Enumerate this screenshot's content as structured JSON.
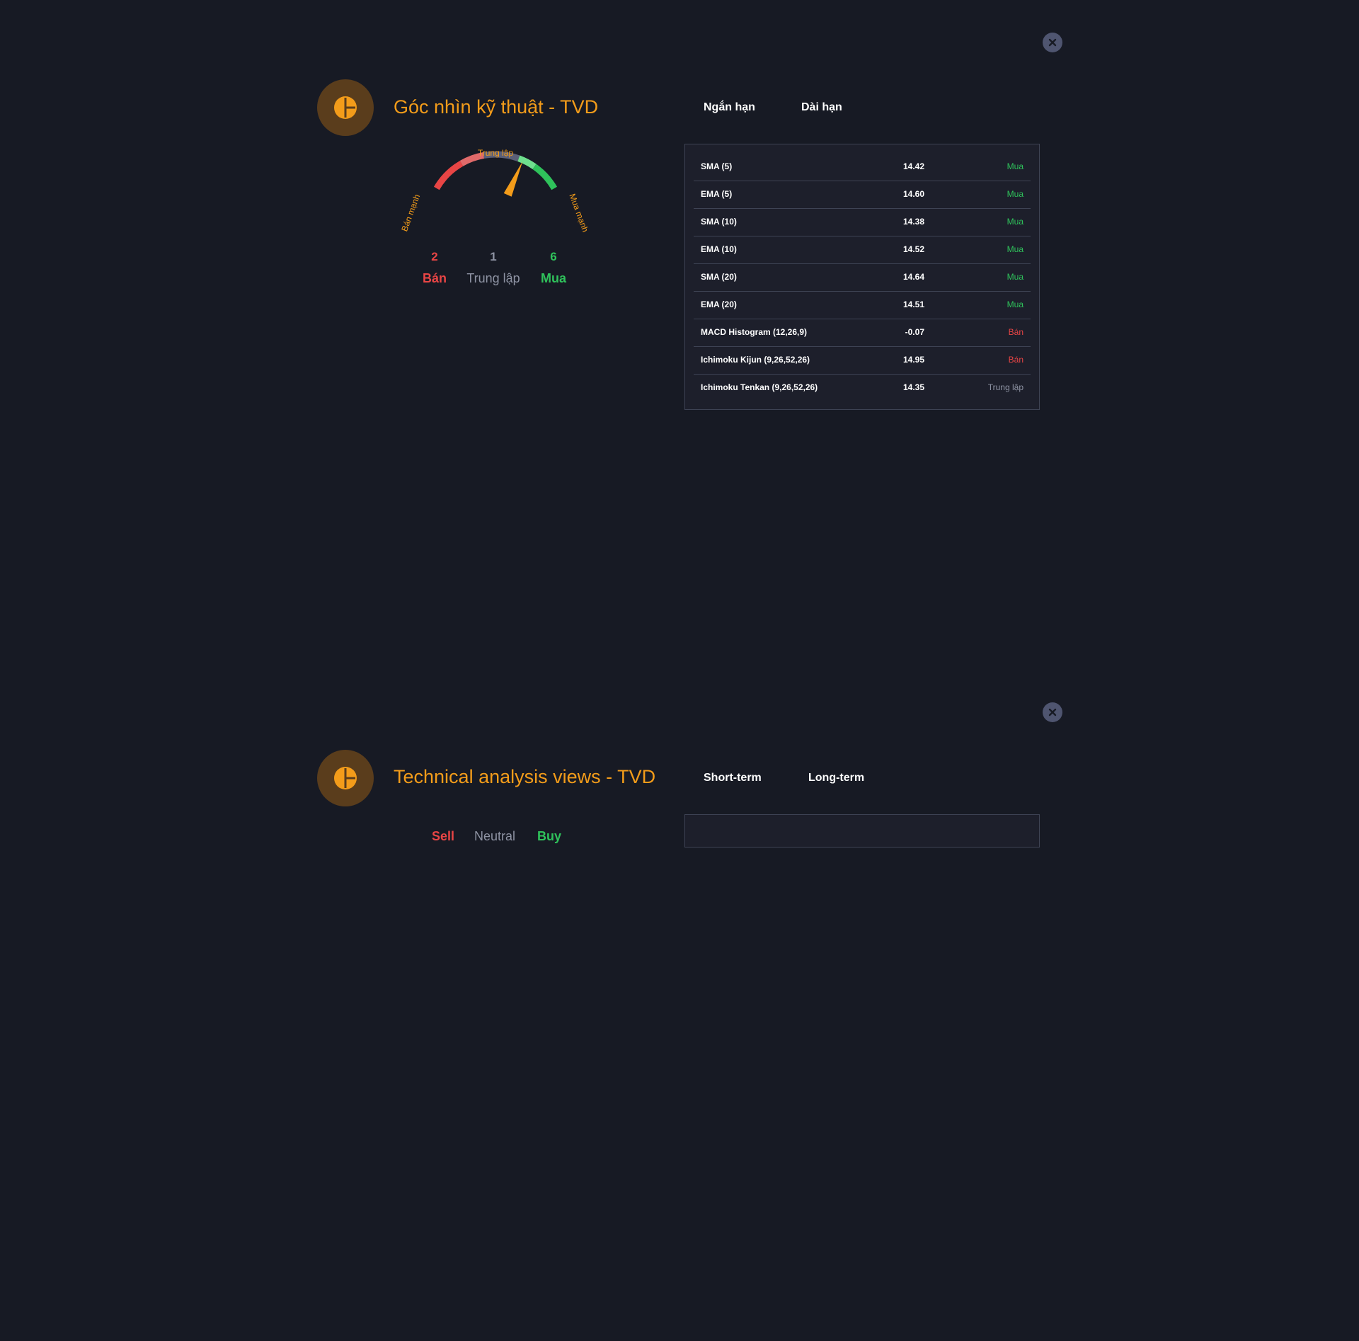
{
  "colors": {
    "background": "#171a24",
    "accent": "#f39c1a",
    "sell": "#e84545",
    "neutral": "#8e93a3",
    "buy": "#2fc25b"
  },
  "panel_vi": {
    "close_icon": "close-icon",
    "header_icon": "pie-chart-icon",
    "title": "Góc nhìn kỹ thuật - TVD",
    "tabs": [
      "Ngắn hạn",
      "Dài hạn"
    ],
    "gauge": {
      "label_left": "Bán mạnh",
      "label_top": "Trung lập",
      "label_right": "Mua mạnh",
      "needle_level_percent": 70
    },
    "counts": {
      "sell": "2",
      "neutral": "1",
      "buy": "6",
      "sell_label": "Bán",
      "neutral_label": "Trung lập",
      "buy_label": "Mua"
    },
    "indicators": [
      {
        "name": "SMA (5)",
        "value": "14.42",
        "signal": "Mua",
        "type": "buy"
      },
      {
        "name": "EMA (5)",
        "value": "14.60",
        "signal": "Mua",
        "type": "buy"
      },
      {
        "name": "SMA (10)",
        "value": "14.38",
        "signal": "Mua",
        "type": "buy"
      },
      {
        "name": "EMA (10)",
        "value": "14.52",
        "signal": "Mua",
        "type": "buy"
      },
      {
        "name": "SMA (20)",
        "value": "14.64",
        "signal": "Mua",
        "type": "buy"
      },
      {
        "name": "EMA (20)",
        "value": "14.51",
        "signal": "Mua",
        "type": "buy"
      },
      {
        "name": "MACD Histogram (12,26,9)",
        "value": "-0.07",
        "signal": "Bán",
        "type": "sell"
      },
      {
        "name": "Ichimoku Kijun (9,26,52,26)",
        "value": "14.95",
        "signal": "Bán",
        "type": "sell"
      },
      {
        "name": "Ichimoku Tenkan (9,26,52,26)",
        "value": "14.35",
        "signal": "Trung lập",
        "type": "neutral"
      }
    ]
  },
  "panel_en": {
    "close_icon": "close-icon",
    "header_icon": "pie-chart-icon",
    "title": "Technical analysis views - TVD",
    "tabs": [
      "Short-term",
      "Long-term"
    ],
    "legend": {
      "sell": "Sell",
      "neutral": "Neutral",
      "buy": "Buy"
    }
  }
}
